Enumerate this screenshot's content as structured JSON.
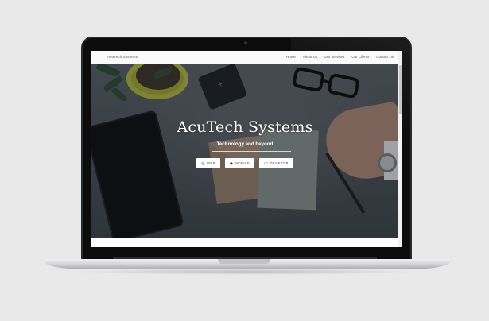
{
  "nav": {
    "brand": "AcuTech Systems",
    "links": [
      "Home",
      "About Us",
      "Our Services",
      "Our Clients",
      "Contact Us"
    ]
  },
  "hero": {
    "title": "AcuTech Systems",
    "subtitle": "Technology and beyond",
    "buttons": [
      {
        "label": "WEB",
        "icon": "globe-icon"
      },
      {
        "label": "MOBILE",
        "icon": "mobile-icon"
      },
      {
        "label": "DESKTOP",
        "icon": "desktop-icon"
      }
    ]
  },
  "colors": {
    "page_background": "#e9e9e9",
    "laptop_bezel": "#0c0c0d",
    "hero_text": "#ffffff",
    "button_background": "#ffffff"
  }
}
